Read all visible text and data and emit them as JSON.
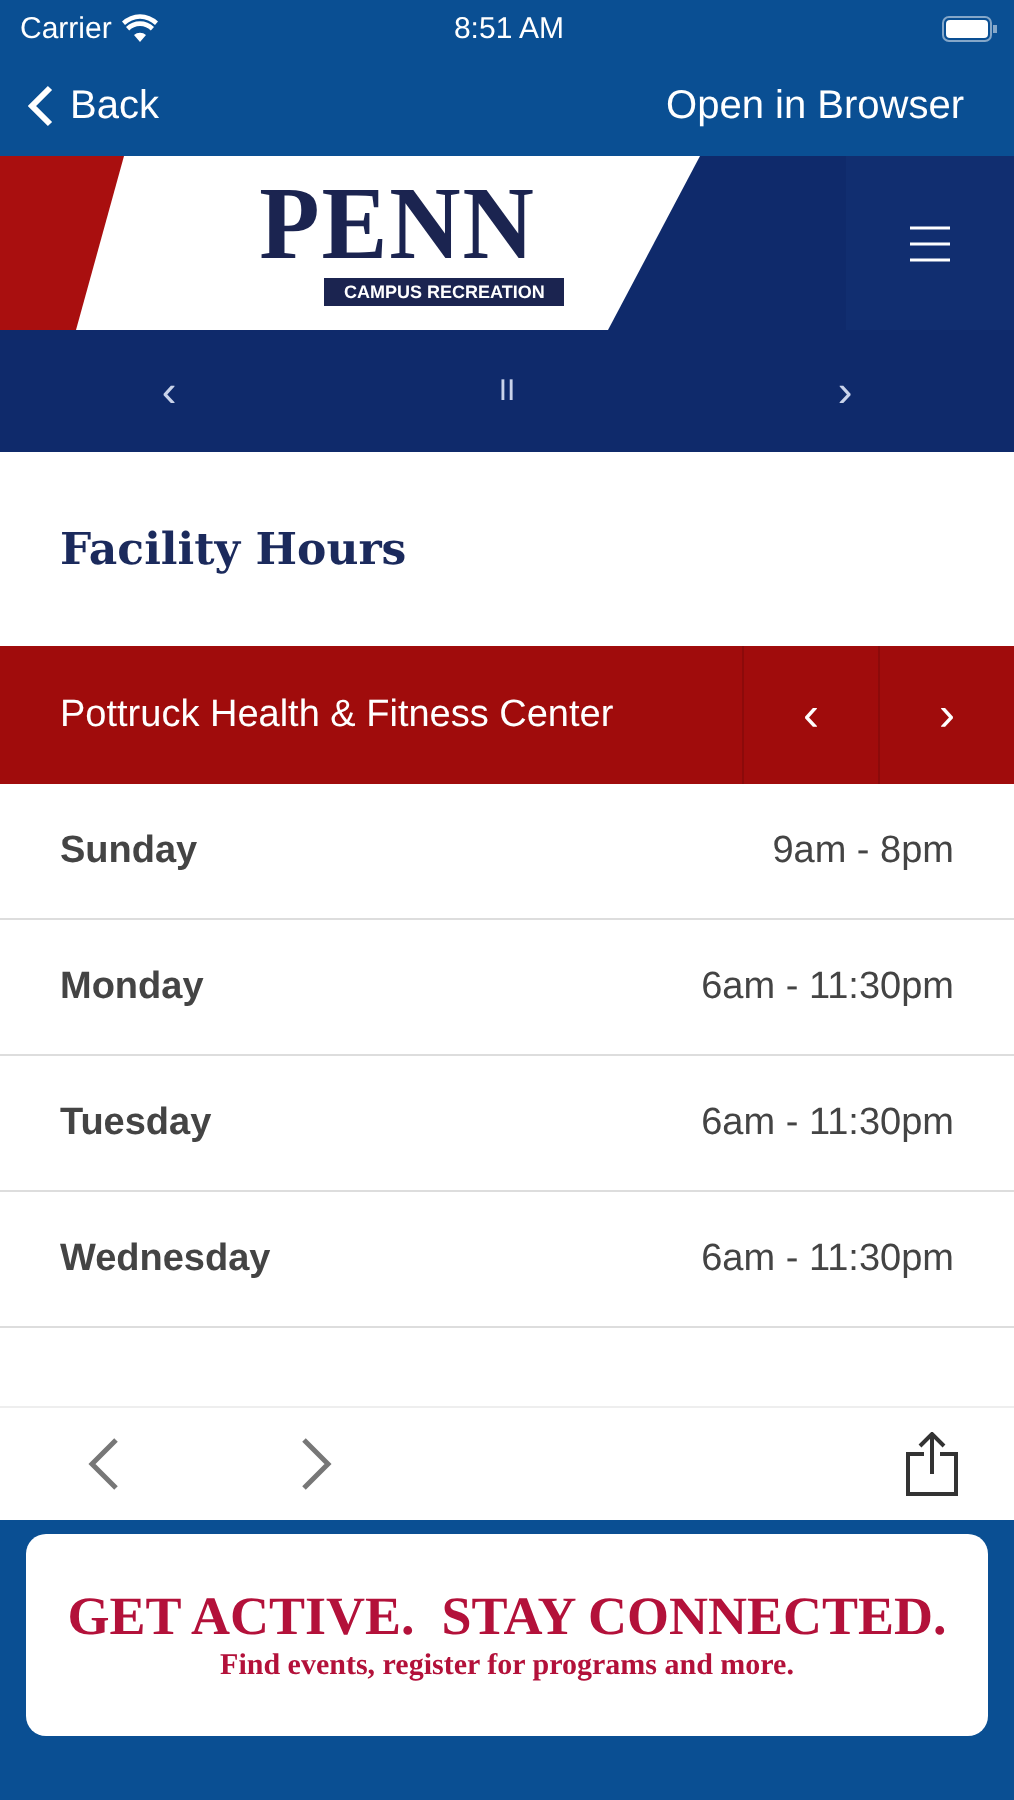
{
  "status_bar": {
    "carrier": "Carrier",
    "time": "8:51 AM"
  },
  "nav": {
    "back": "Back",
    "action": "Open in Browser"
  },
  "logo": {
    "word": "PENN",
    "tagline": "CAMPUS RECREATION"
  },
  "slider_controls": {
    "prev": "‹",
    "pause": "II",
    "next": "›"
  },
  "page_title": "Facility Hours",
  "facility": {
    "name": "Pottruck Health & Fitness Center",
    "prev": "‹",
    "next": "›"
  },
  "hours": [
    {
      "day": "Sunday",
      "time": "9am - 8pm"
    },
    {
      "day": "Monday",
      "time": "6am - 11:30pm"
    },
    {
      "day": "Tuesday",
      "time": "6am - 11:30pm"
    },
    {
      "day": "Wednesday",
      "time": "6am - 11:30pm"
    }
  ],
  "ad": {
    "headline": "GET ACTIVE.  STAY CONNECTED.",
    "subline": "Find events, register for programs and more."
  }
}
